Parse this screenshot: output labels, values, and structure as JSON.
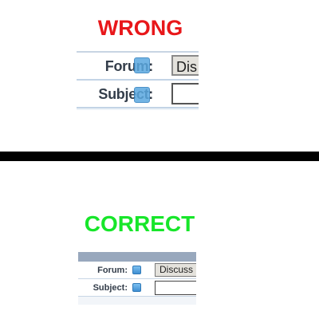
{
  "wrong": {
    "heading": "WRONG",
    "heading_color": "#e8171a",
    "forum_label": "Forum:",
    "subject_label": "Subject:",
    "forum_value": "Dis",
    "subject_value": "",
    "help_icon": "help-icon"
  },
  "correct": {
    "heading": "CORRECT",
    "heading_color": "#17e62a",
    "forum_label": "Forum:",
    "subject_label": "Subject:",
    "forum_value": "Discuss",
    "subject_value": "",
    "help_icon": "help-icon"
  }
}
